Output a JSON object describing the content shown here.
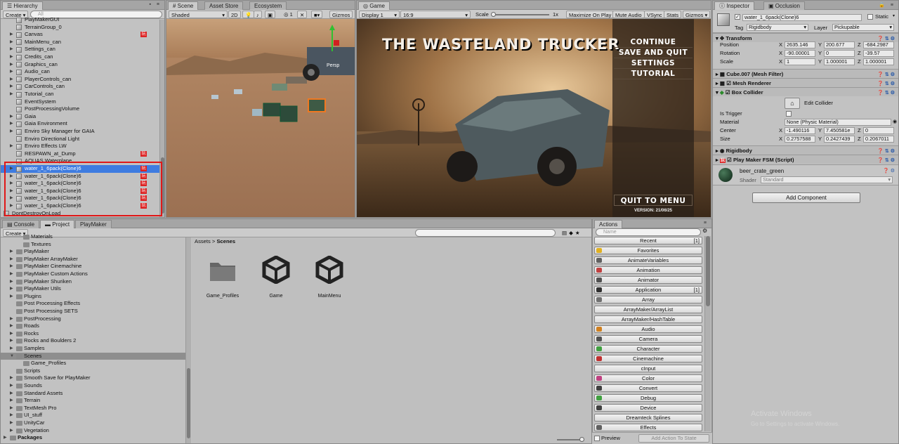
{
  "hierarchy": {
    "tab": "Hierarchy",
    "create": "Create",
    "search_placeholder": "All",
    "items": [
      {
        "label": "PlayMakerGUI",
        "indent": 2,
        "arrow": false,
        "pm": false
      },
      {
        "label": "TerrainGroup_0",
        "indent": 2,
        "arrow": false,
        "pm": false
      },
      {
        "label": "Canvas",
        "indent": 2,
        "arrow": true,
        "pm": true
      },
      {
        "label": "MainMenu_can",
        "indent": 2,
        "arrow": true,
        "pm": false
      },
      {
        "label": "Settings_can",
        "indent": 2,
        "arrow": true,
        "pm": false
      },
      {
        "label": "Credits_can",
        "indent": 2,
        "arrow": true,
        "pm": false
      },
      {
        "label": "Graphics_can",
        "indent": 2,
        "arrow": true,
        "pm": false
      },
      {
        "label": "Audio_can",
        "indent": 2,
        "arrow": true,
        "pm": false
      },
      {
        "label": "PlayerControls_can",
        "indent": 2,
        "arrow": true,
        "pm": false
      },
      {
        "label": "CarControls_can",
        "indent": 2,
        "arrow": true,
        "pm": false
      },
      {
        "label": "Tutorial_can",
        "indent": 2,
        "arrow": true,
        "pm": false
      },
      {
        "label": "EventSystem",
        "indent": 2,
        "arrow": false,
        "pm": false
      },
      {
        "label": "PostProcessingVolume",
        "indent": 2,
        "arrow": false,
        "pm": false
      },
      {
        "label": "Gaia",
        "indent": 2,
        "arrow": true,
        "pm": false
      },
      {
        "label": "Gaia Environment",
        "indent": 2,
        "arrow": true,
        "pm": false
      },
      {
        "label": "Enviro Sky Manager for GAIA",
        "indent": 2,
        "arrow": true,
        "pm": false
      },
      {
        "label": "Enviro Directional Light",
        "indent": 2,
        "arrow": false,
        "pm": false
      },
      {
        "label": "Enviro Effects LW",
        "indent": 2,
        "arrow": true,
        "pm": false
      },
      {
        "label": "RESPAWN_at_Dump",
        "indent": 2,
        "arrow": false,
        "pm": true
      },
      {
        "label": "AQUAS Waterplane",
        "indent": 2,
        "arrow": false,
        "pm": false
      },
      {
        "label": "water_1_6pack(Clone)6",
        "indent": 2,
        "arrow": true,
        "pm": true,
        "selected": true
      },
      {
        "label": "water_1_6pack(Clone)6",
        "indent": 2,
        "arrow": true,
        "pm": true
      },
      {
        "label": "water_1_6pack(Clone)6",
        "indent": 2,
        "arrow": true,
        "pm": true
      },
      {
        "label": "water_1_6pack(Clone)6",
        "indent": 2,
        "arrow": true,
        "pm": true
      },
      {
        "label": "water_1_6pack(Clone)6",
        "indent": 2,
        "arrow": true,
        "pm": true
      },
      {
        "label": "water_1_6pack(Clone)6",
        "indent": 2,
        "arrow": true,
        "pm": true
      },
      {
        "label": "DontDestroyOnLoad",
        "indent": 0,
        "arrow": true,
        "pm": false
      }
    ]
  },
  "scene": {
    "tabs": [
      "Scene",
      "Asset Store",
      "Ecosystem"
    ],
    "shading": "Shaded",
    "mode2d": "2D",
    "layers_count": "1",
    "gizmos": "Gizmos",
    "persp": "Persp",
    "search_placeholder": "All"
  },
  "game": {
    "tab": "Game",
    "display": "Display 1",
    "aspect": "16:9",
    "scale_label": "Scale",
    "scale_value": "1x",
    "buttons": [
      "Maximize On Play",
      "Mute Audio",
      "VSync",
      "Stats",
      "Gizmos"
    ],
    "title": "THE WASTELAND TRUCKER",
    "menu": [
      "CONTINUE",
      "SAVE AND QUIT",
      "SETTINGS",
      "TUTORIAL"
    ],
    "quit": "QUIT TO MENU",
    "version": "VERSION: 21/06/25"
  },
  "inspector": {
    "tabs": [
      "Inspector",
      "Occlusion"
    ],
    "object_name": "water_1_6pack(Clone)6",
    "static_label": "Static",
    "tag_label": "Tag",
    "tag_value": "Rigidbody",
    "layer_label": "Layer",
    "layer_value": "Pickupable",
    "transform": {
      "title": "Transform",
      "rows": [
        {
          "label": "Position",
          "x": "2635.146",
          "y": "200.677",
          "z": "-684.2987"
        },
        {
          "label": "Rotation",
          "x": "-90.00001",
          "y": "0",
          "z": "-39.57"
        },
        {
          "label": "Scale",
          "x": "1",
          "y": "1.000001",
          "z": "1.000001"
        }
      ]
    },
    "mesh_filter": "Cube.007 (Mesh Filter)",
    "mesh_renderer": "Mesh Renderer",
    "box_collider": "Box Collider",
    "edit_collider": "Edit Collider",
    "is_trigger": "Is Trigger",
    "material_label": "Material",
    "material_value": "None (Physic Material)",
    "center_label": "Center",
    "center": {
      "x": "-1.490116",
      "y": "7.450581e",
      "z": "0"
    },
    "size_label": "Size",
    "size": {
      "x": "0.2757588",
      "y": "0.2427439",
      "z": "0.2067011"
    },
    "rigidbody": "Rigidbody",
    "fsm": "Play Maker FSM (Script)",
    "material_name": "beer_crate_green",
    "shader_label": "Shader",
    "shader_value": "Standard",
    "add_component": "Add Component"
  },
  "project": {
    "tabs": [
      "Console",
      "Project",
      "PlayMaker"
    ],
    "create": "Create",
    "breadcrumb": [
      "Assets",
      "Scenes"
    ],
    "tree": [
      {
        "label": "Materials",
        "indent": 1,
        "arrow": false
      },
      {
        "label": "Textures",
        "indent": 1,
        "arrow": false
      },
      {
        "label": "PlayMaker",
        "indent": 0,
        "arrow": true
      },
      {
        "label": "PlayMaker ArrayMaker",
        "indent": 0,
        "arrow": true
      },
      {
        "label": "PlayMaker Cinemachine",
        "indent": 0,
        "arrow": true
      },
      {
        "label": "PlayMaker Custom Actions",
        "indent": 0,
        "arrow": true
      },
      {
        "label": "PlayMaker Shuriken",
        "indent": 0,
        "arrow": true
      },
      {
        "label": "PlayMaker Utils",
        "indent": 0,
        "arrow": true
      },
      {
        "label": "Plugins",
        "indent": 0,
        "arrow": true
      },
      {
        "label": "Post Processing Effects",
        "indent": 0,
        "arrow": false
      },
      {
        "label": "Post Processing SETS",
        "indent": 0,
        "arrow": false
      },
      {
        "label": "PostProcessing",
        "indent": 0,
        "arrow": true
      },
      {
        "label": "Roads",
        "indent": 0,
        "arrow": true
      },
      {
        "label": "Rocks",
        "indent": 0,
        "arrow": true
      },
      {
        "label": "Rocks and Boulders 2",
        "indent": 0,
        "arrow": true
      },
      {
        "label": "Samples",
        "indent": 0,
        "arrow": true
      },
      {
        "label": "Scenes",
        "indent": 0,
        "arrow": true,
        "selected": true
      },
      {
        "label": "Game_Profiles",
        "indent": 1,
        "arrow": false
      },
      {
        "label": "Scripts",
        "indent": 0,
        "arrow": false
      },
      {
        "label": "Smooth Save for PlayMaker",
        "indent": 0,
        "arrow": true
      },
      {
        "label": "Sounds",
        "indent": 0,
        "arrow": true
      },
      {
        "label": "Standard Assets",
        "indent": 0,
        "arrow": true
      },
      {
        "label": "Terrain",
        "indent": 0,
        "arrow": true
      },
      {
        "label": "TextMesh Pro",
        "indent": 0,
        "arrow": true
      },
      {
        "label": "UI_stuff",
        "indent": 0,
        "arrow": true
      },
      {
        "label": "UnityCar",
        "indent": 0,
        "arrow": true
      },
      {
        "label": "Vegetation",
        "indent": 0,
        "arrow": true
      }
    ],
    "packages": "Packages",
    "assets": [
      {
        "label": "Game_Profiles",
        "kind": "folder"
      },
      {
        "label": "Game",
        "kind": "unity"
      },
      {
        "label": "MainMenu",
        "kind": "unity"
      }
    ]
  },
  "actions": {
    "tab": "Actions",
    "search_placeholder": "Name",
    "items": [
      {
        "label": "Recent",
        "count": "[1]",
        "icon": ""
      },
      {
        "label": "Favorites",
        "count": "",
        "icon": "#e0b020"
      },
      {
        "label": "AnimateVariables",
        "count": "",
        "icon": "#606060"
      },
      {
        "label": "Animation",
        "count": "",
        "icon": "#c04040"
      },
      {
        "label": "Animator",
        "count": "",
        "icon": "#505050"
      },
      {
        "label": "Application",
        "count": "[1]",
        "icon": "#303030"
      },
      {
        "label": "Array",
        "count": "",
        "icon": "#707070"
      },
      {
        "label": "ArrayMaker/ArrayList",
        "count": "",
        "icon": ""
      },
      {
        "label": "ArrayMaker/HashTable",
        "count": "",
        "icon": ""
      },
      {
        "label": "Audio",
        "count": "",
        "icon": "#d08020"
      },
      {
        "label": "Camera",
        "count": "",
        "icon": "#505050"
      },
      {
        "label": "Character",
        "count": "",
        "icon": "#40a040"
      },
      {
        "label": "Cinemachine",
        "count": "",
        "icon": "#c03030"
      },
      {
        "label": "cInput",
        "count": "",
        "icon": ""
      },
      {
        "label": "Color",
        "count": "",
        "icon": "#c04080"
      },
      {
        "label": "Convert",
        "count": "",
        "icon": "#404040"
      },
      {
        "label": "Debug",
        "count": "",
        "icon": "#40a040"
      },
      {
        "label": "Device",
        "count": "",
        "icon": "#404040"
      },
      {
        "label": "Dreamteck Splines",
        "count": "",
        "icon": ""
      },
      {
        "label": "Effects",
        "count": "",
        "icon": "#606060"
      }
    ],
    "preview_label": "Preview",
    "add_action": "Add Action To State"
  },
  "watermark": {
    "line1": "Activate Windows",
    "line2": "Go to Settings to activate Windows."
  },
  "colors": {
    "selection": "#3e7ce0",
    "highlight_box": "#e01818",
    "panel": "#c2c2c2"
  }
}
